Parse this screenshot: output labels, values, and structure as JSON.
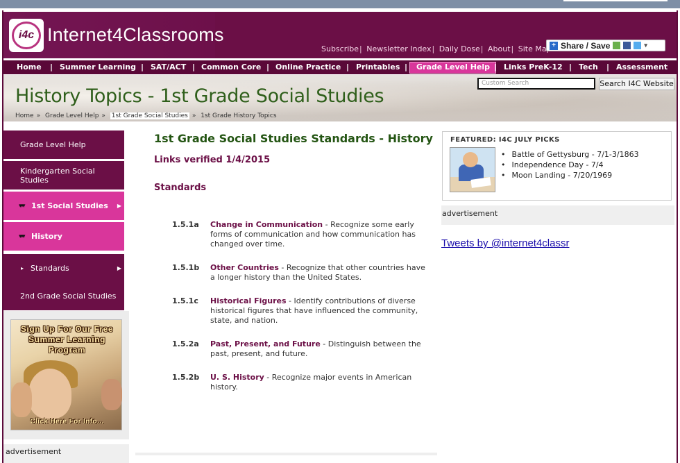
{
  "header": {
    "logo_badge": "i4c",
    "site_name": "Internet4Classrooms",
    "top_links": [
      "Subscribe",
      "Newsletter Index",
      "Daily Dose",
      "About",
      "Site Map"
    ],
    "share_label": "Share / Save"
  },
  "nav": {
    "items": [
      "Home",
      "Summer Learning",
      "SAT/ACT",
      "Common Core",
      "Online Practice",
      "Printables",
      "Grade Level Help",
      "Links PreK-12",
      "Tech",
      "Assessment"
    ],
    "active": "Grade Level Help"
  },
  "banner": {
    "title": "History Topics - 1st Grade Social Studies",
    "breadcrumbs": [
      "Home",
      "Grade Level Help",
      "1st Grade Social Studies",
      "1st Grade History Topics"
    ],
    "search_placeholder": "Custom Search",
    "search_button": "Search I4C Website"
  },
  "sidebar": {
    "items": [
      {
        "label": "Grade Level Help"
      },
      {
        "label": "Kindergarten Social Studies"
      },
      {
        "label": "1st Social Studies"
      },
      {
        "label": "History"
      },
      {
        "label": "Standards"
      },
      {
        "label": "2nd Grade Social Studies"
      }
    ],
    "promo_text": "Sign Up For Our Free Summer Learning Program",
    "promo_cta": "Click Here For Info...",
    "ad_label": "advertisement"
  },
  "main": {
    "title": "1st Grade Social Studies Standards - History",
    "verified": "Links verified 1/4/2015",
    "standards_heading": "Standards",
    "standards": [
      {
        "code": "1.5.1a",
        "name": "Change in Communication",
        "desc": " - Recognize some early forms of communication and how communication has changed over time."
      },
      {
        "code": "1.5.1b",
        "name": "Other Countries",
        "desc": " - Recognize that other countries have a longer history than the United States."
      },
      {
        "code": "1.5.1c",
        "name": "Historical Figures",
        "desc": " - Identify contributions of diverse historical figures that have influenced the community, state, and nation."
      },
      {
        "code": "1.5.2a",
        "name": "Past, Present, and Future",
        "desc": " - Distinguish between the past, present, and future."
      },
      {
        "code": "1.5.2b",
        "name": "U. S. History",
        "desc": " - Recognize major events in American history."
      }
    ]
  },
  "featured": {
    "title": "FEATURED: I4C JULY PICKS",
    "items": [
      "Battle of Gettysburg - 7/1-3/1863",
      "Independence Day - 7/4",
      "Moon Landing - 7/20/1969"
    ]
  },
  "right": {
    "ad_label": "advertisement",
    "tweets_link": "Tweets by @internet4classr"
  },
  "colors": {
    "brand": "#6b0f46",
    "accent": "#d9369b",
    "title_green": "#245513"
  }
}
